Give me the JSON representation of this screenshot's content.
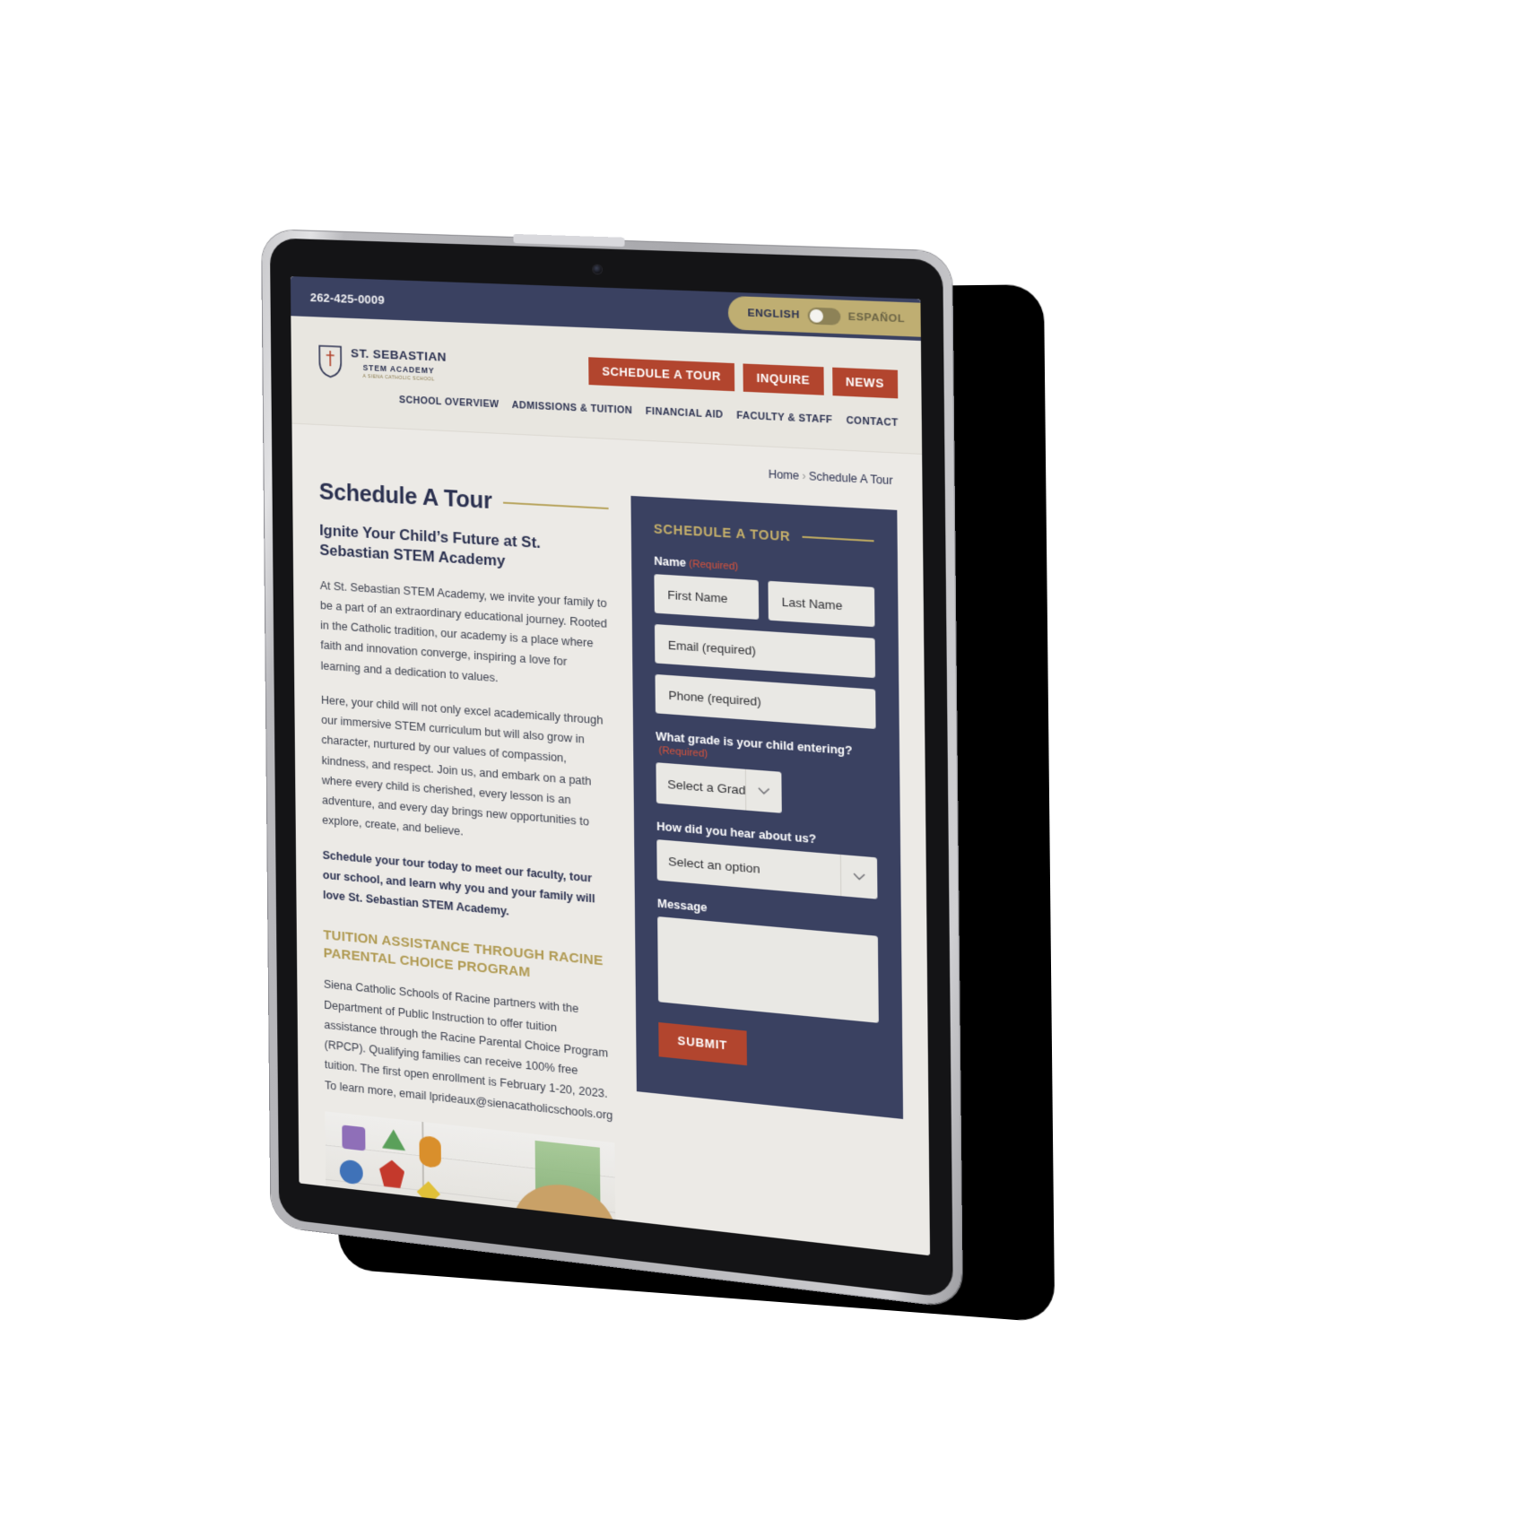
{
  "utility_bar": {
    "phone": "262-425-0009",
    "language_toggle": {
      "active_label": "ENGLISH",
      "inactive_label": "ESPAÑOL",
      "state": "english"
    }
  },
  "header": {
    "logo": {
      "name": "ST. SEBASTIAN",
      "sub": "STEM ACADEMY",
      "tagline": "A SIENA CATHOLIC SCHOOL"
    },
    "cta_buttons": [
      {
        "label": "SCHEDULE A TOUR"
      },
      {
        "label": "INQUIRE"
      },
      {
        "label": "NEWS"
      }
    ],
    "nav_items": [
      {
        "label": "SCHOOL OVERVIEW"
      },
      {
        "label": "ADMISSIONS & TUITION"
      },
      {
        "label": "FINANCIAL AID"
      },
      {
        "label": "FACULTY & STAFF"
      },
      {
        "label": "CONTACT"
      }
    ]
  },
  "breadcrumb": {
    "home": "Home",
    "separator": "›",
    "current": "Schedule A Tour"
  },
  "main": {
    "page_title": "Schedule A Tour",
    "sub_heading": "Ignite Your Child’s Future at St. Sebastian STEM Academy",
    "paragraph_1": "At St. Sebastian STEM Academy, we invite your family to be a part of an extraordinary educational journey. Rooted in the Catholic tradition, our academy is a place where faith and innovation converge, inspiring a love for learning and a dedication to values.",
    "paragraph_2": "Here, your child will not only excel academically through our immersive STEM curriculum but will also grow in character, nurtured by our values of compassion, kindness, and respect. Join us, and embark on a path where every child is cherished, every lesson is an adventure, and every day brings new opportunities to explore, create, and believe.",
    "paragraph_3_bold": "Schedule your tour today to meet our faculty, tour our school, and learn why you and your family will love St. Sebastian STEM Academy.",
    "gold_heading": "TUITION ASSISTANCE THROUGH RACINE PARENTAL CHOICE PROGRAM",
    "paragraph_4": "Siena Catholic Schools of Racine partners with the Department of Public Instruction to offer tuition assistance through the Racine Parental Choice Program (RPCP). Qualifying families can receive 100% free tuition. The first open enrollment is February 1-20, 2023. To learn more, email lprideaux@sienacatholicschools.org"
  },
  "form": {
    "heading": "SCHEDULE A TOUR",
    "name_label": "Name",
    "name_required": "(Required)",
    "first_name_placeholder": "First Name",
    "last_name_placeholder": "Last Name",
    "email_placeholder": "Email (required)",
    "phone_placeholder": "Phone (required)",
    "grade_label": "What grade is your child entering?",
    "grade_required": "(Required)",
    "grade_selected": "Select a Grade",
    "hear_label": "How did you hear about us?",
    "hear_selected": "Select an option",
    "message_label": "Message",
    "message_value": "",
    "submit_label": "SUBMIT"
  },
  "colors": {
    "navy": "#3a4161",
    "gold": "#b9a661",
    "brick": "#b2452e",
    "cream": "#e8e6e0",
    "page_bg": "#eceae6",
    "required_red": "#d8523a"
  }
}
